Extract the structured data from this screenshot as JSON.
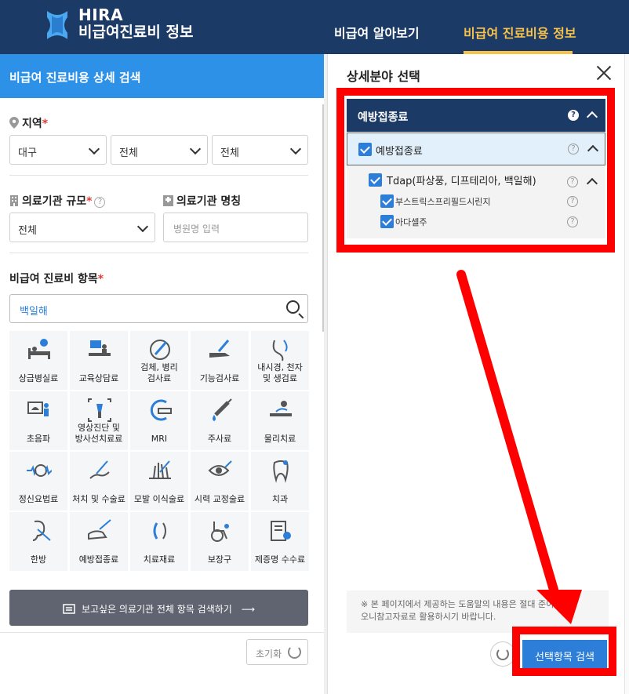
{
  "header": {
    "brand_top": "HIRA",
    "brand_bottom": "비급여진료비 정보",
    "nav": [
      {
        "label": "비급여 알아보기"
      },
      {
        "label": "비급여 진료비용 정보"
      }
    ]
  },
  "left": {
    "title": "비급여 진료비용 상세 검색",
    "region_label": "지역",
    "region_selects": [
      "대구",
      "전체",
      "전체"
    ],
    "scale_label": "의료기관 규모",
    "scale_select": "전체",
    "name_label": "의료기관 명칭",
    "name_placeholder": "병원명 입력",
    "item_label": "비급여 진료비 항목",
    "search_value": "백일해",
    "categories": [
      {
        "label": "상급병실료"
      },
      {
        "label": "교육상담료"
      },
      {
        "label": "검체, 병리\n검사료"
      },
      {
        "label": "기능검사료"
      },
      {
        "label": "내시경, 천자\n및 생검료"
      },
      {
        "label": "초음파"
      },
      {
        "label": "영상진단 및\n방사선치료료"
      },
      {
        "label": "MRI"
      },
      {
        "label": "주사료"
      },
      {
        "label": "물리치료"
      },
      {
        "label": "정신요법료"
      },
      {
        "label": "처치 및 수술료"
      },
      {
        "label": "모발 이식술료"
      },
      {
        "label": "시력 교정술료"
      },
      {
        "label": "치과"
      },
      {
        "label": "한방"
      },
      {
        "label": "예방접종료"
      },
      {
        "label": "치료재료"
      },
      {
        "label": "보장구"
      },
      {
        "label": "제증명 수수료"
      }
    ],
    "all_items_button": "보고싶은 의료기관 전체 항목 검색하기",
    "reset_button": "초기화"
  },
  "modal": {
    "title": "상세분야 선택",
    "tree_head": "예방접종료",
    "level1": "예방접종료",
    "level2": "Tdap(파상풍, 디프테리아, 백일해)",
    "level3": [
      "부스트릭스프리필드시린지",
      "아다셀주"
    ],
    "notice_line1": "※ 본 페이지에서 제공하는 도움말의 내용은 절대   준이 아니",
    "notice_line2": "오니참고자료로 활용하시기 바랍니다.",
    "search_button": "선택항목 검색"
  },
  "colors": {
    "header_bg": "#1c3a66",
    "accent_yellow": "#f7c24a",
    "accent_blue": "#2d91e8",
    "annotation_red": "#ff0000"
  }
}
